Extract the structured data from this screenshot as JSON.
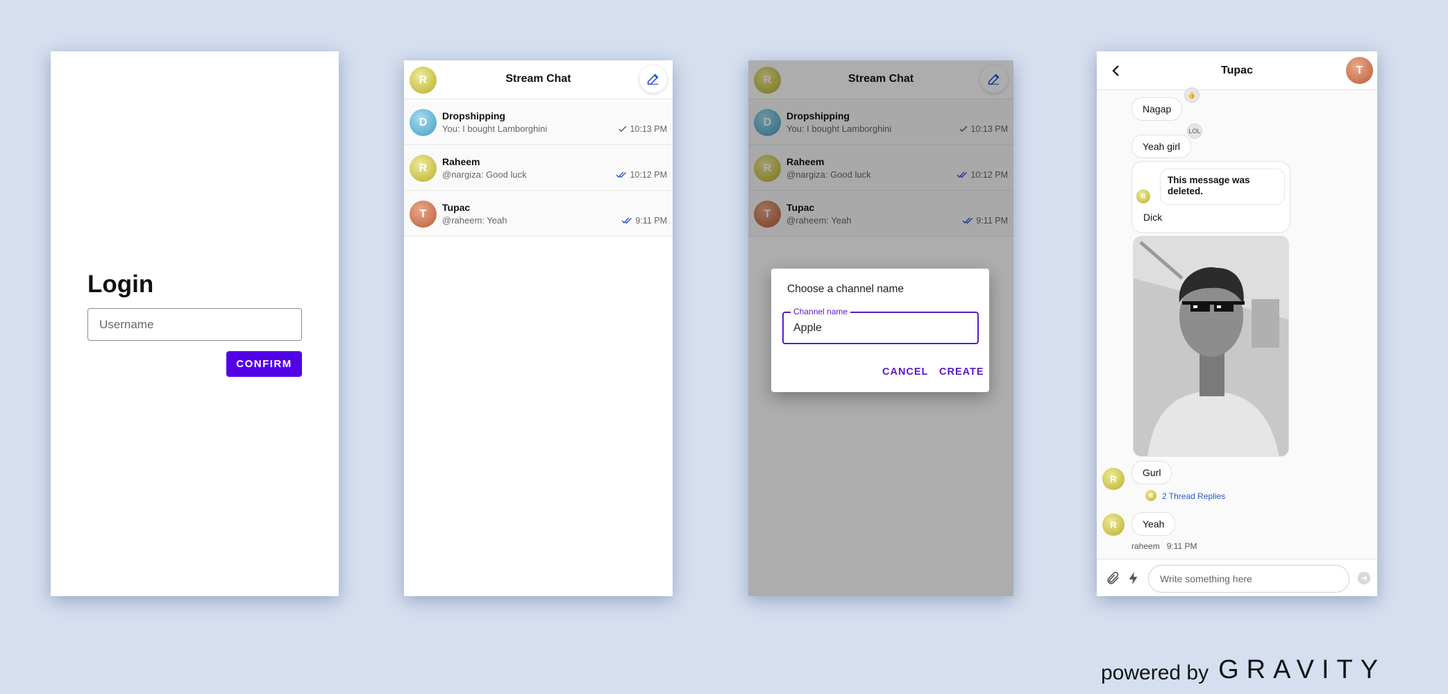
{
  "colors": {
    "background": "#d5dff0",
    "accent": "#5200e8",
    "dialog_accent": "#5a18c9",
    "link": "#2a55d0"
  },
  "login": {
    "title": "Login",
    "username_placeholder": "Username",
    "confirm_label": "CONFIRM"
  },
  "channel_list": {
    "title": "Stream Chat",
    "user_avatar_initial": "R",
    "compose_icon": "pencil-icon",
    "channels": [
      {
        "initial": "D",
        "name": "Dropshipping",
        "preview": "You: I bought Lamborghini",
        "time": "10:13 PM",
        "read_state": "sent"
      },
      {
        "initial": "R",
        "name": "Raheem",
        "preview": "@nargiza: Good luck",
        "time": "10:12 PM",
        "read_state": "read"
      },
      {
        "initial": "T",
        "name": "Tupac",
        "preview": "@raheem: Yeah",
        "time": "9:11 PM",
        "read_state": "read"
      }
    ]
  },
  "create_dialog": {
    "title": "Choose a channel name",
    "field_label": "Channel name",
    "field_value": "Apple",
    "cancel_label": "CANCEL",
    "create_label": "CREATE"
  },
  "chat": {
    "title": "Tupac",
    "header_avatar_initial": "T",
    "messages": {
      "m1": "Nagap",
      "m2": "Yeah girl",
      "m2_reaction": "LOL",
      "deleted": "This message was deleted.",
      "m3": "Dick",
      "m4": "Gurl",
      "thread_replies": "2 Thread Replies",
      "m5": "Yeah"
    },
    "sender_avatar_initial": "R",
    "meta_user": "raheem",
    "meta_time": "9:11 PM",
    "composer_placeholder": "Write something here"
  },
  "brand": {
    "powered_by": "powered by",
    "logo": "GRAVITY"
  }
}
